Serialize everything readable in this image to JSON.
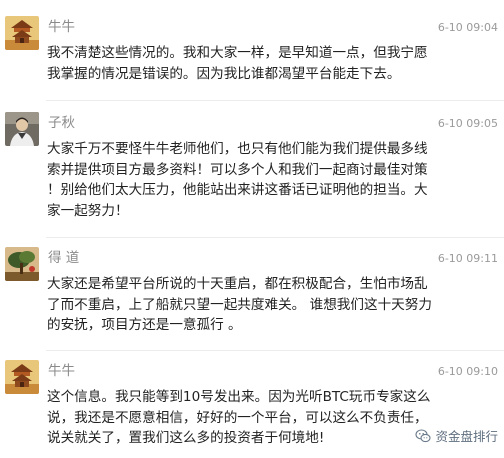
{
  "comments": [
    {
      "name": "牛牛",
      "time": "6-10 09:04",
      "text": "我不清楚这些情况的。我和大家一样，是早知道一点，但我宁愿\n我掌握的情况是错误的。因为我比谁都渴望平台能走下去。",
      "avatar": "avatar-pavilion-icon"
    },
    {
      "name": "子秋",
      "time": "6-10 09:05",
      "text": "大家千万不要怪牛牛老师他们，也只有他们能为我们提供最多线\n索并提供项目方最多资料！可以多个人和我们一起商讨最佳对策\n！别给他们太大压力，他能站出来讲这番话已证明他的担当。大\n家一起努力！",
      "avatar": "avatar-person-icon"
    },
    {
      "name": "得 道",
      "time": "6-10 09:11",
      "text": "大家还是希望平台所说的十天重启，都在积极配合，生怕市场乱\n了而不重启，上了船就只望一起共度难关。 谁想我们这十天努力\n的安抚，项目方还是一意孤行 。",
      "avatar": "avatar-tree-icon"
    },
    {
      "name": "牛牛",
      "time": "6-10 09:10",
      "text": "这个信息。我只能等到10号发出来。因为光听BTC玩币专家这么\n说，我还是不愿意相信，好好的一个平台，可以这么不负责任，\n说关就关了，置我们这么多的投资者于何境地!",
      "avatar": "avatar-pavilion-icon"
    }
  ],
  "watermark": {
    "text": "资金盘排行",
    "icon": "wechat-icon"
  }
}
